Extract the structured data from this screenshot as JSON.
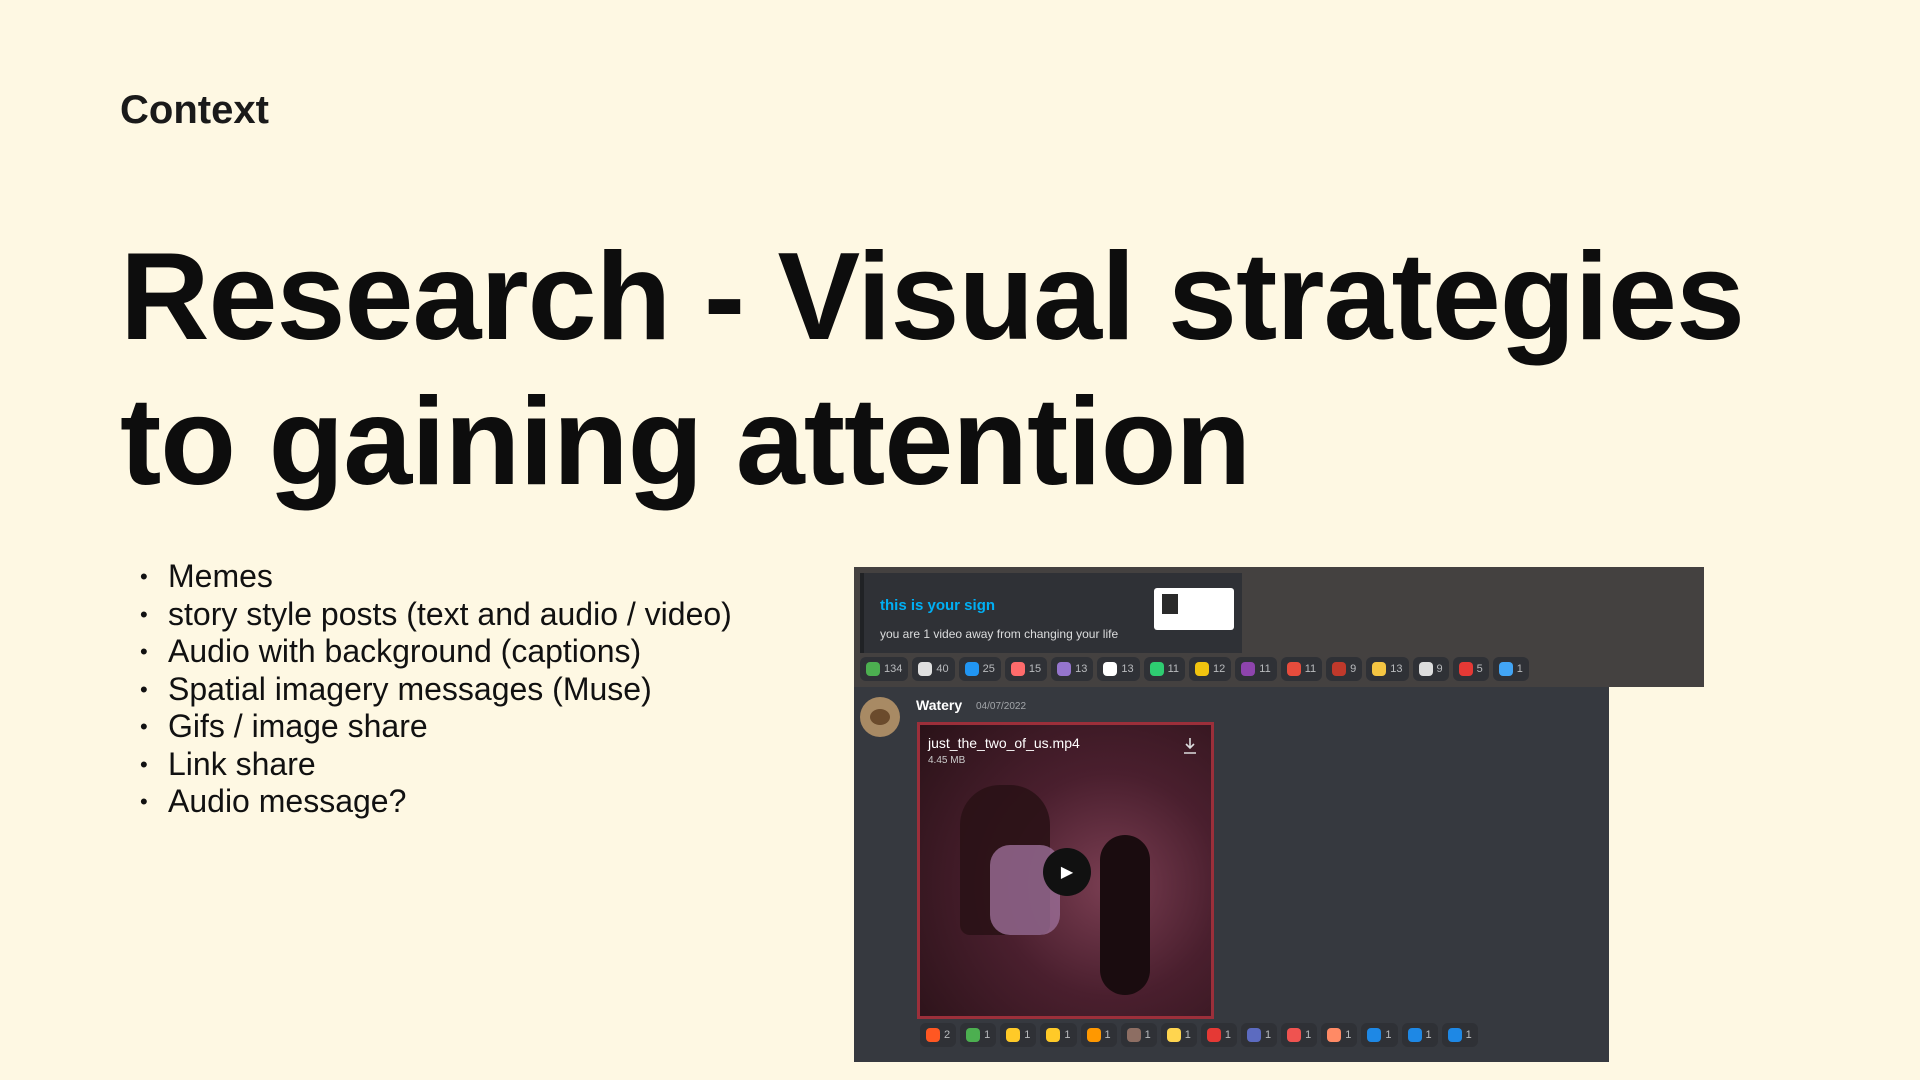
{
  "slide": {
    "eyebrow": "Context",
    "title_line1": "Research - Visual strategies",
    "title_line2": "to gaining attention",
    "bullets": [
      "Memes",
      "story style posts (text and audio / video)",
      "Audio with background (captions)",
      "Spatial imagery messages (Muse)",
      "Gifs / image share",
      "Link share",
      "Audio message?"
    ]
  },
  "screenshot": {
    "embed": {
      "title": "this is your sign",
      "description": "you are 1 video away from changing your life"
    },
    "top_reactions": [
      {
        "icon": "island-emoji",
        "color": "#4caf50",
        "count": "134"
      },
      {
        "icon": "eyes-emoji",
        "color": "#e0e0e0",
        "count": "40"
      },
      {
        "icon": "wave-emoji",
        "color": "#2196f3",
        "count": "25"
      },
      {
        "icon": "pink-emoji",
        "color": "#ff6b6b",
        "count": "15"
      },
      {
        "icon": "sticker-emoji",
        "color": "#9575cd",
        "count": "13"
      },
      {
        "icon": "frame-emoji",
        "color": "#ffffff",
        "count": "13"
      },
      {
        "icon": "green-emoji",
        "color": "#2ecc71",
        "count": "11"
      },
      {
        "icon": "candle-emoji",
        "color": "#f1c40f",
        "count": "12"
      },
      {
        "icon": "purple-emoji",
        "color": "#8e44ad",
        "count": "11"
      },
      {
        "icon": "heart-emoji",
        "color": "#e74c3c",
        "count": "11"
      },
      {
        "icon": "pin-emoji",
        "color": "#c0392b",
        "count": "9"
      },
      {
        "icon": "blob-emoji",
        "color": "#f4c542",
        "count": "13"
      },
      {
        "icon": "diamond-emoji",
        "color": "#dddddd",
        "count": "9"
      },
      {
        "icon": "red-emoji",
        "color": "#e53935",
        "count": "5"
      },
      {
        "icon": "butterfly-emoji",
        "color": "#42a5f5",
        "count": "1"
      }
    ],
    "message": {
      "username": "Watery",
      "date": "04/07/2022",
      "video_name": "just_the_two_of_us.mp4",
      "video_size": "4.45 MB"
    },
    "bottom_reactions": [
      {
        "icon": "arrow-up-emoji",
        "color": "#ff5722",
        "count": "2"
      },
      {
        "icon": "check-emoji",
        "color": "#4caf50",
        "count": "1"
      },
      {
        "icon": "thumbs-up-emoji",
        "color": "#ffca28",
        "count": "1"
      },
      {
        "icon": "grin-emoji",
        "color": "#ffca28",
        "count": "1"
      },
      {
        "icon": "fire-emoji",
        "color": "#ff9800",
        "count": "1"
      },
      {
        "icon": "bird-emoji",
        "color": "#8d6e63",
        "count": "1"
      },
      {
        "icon": "smile-emoji",
        "color": "#ffd54f",
        "count": "1"
      },
      {
        "icon": "red-heart-emoji",
        "color": "#e53935",
        "count": "1"
      },
      {
        "icon": "blue-emoji",
        "color": "#5c6bc0",
        "count": "1"
      },
      {
        "icon": "badge-emoji",
        "color": "#ef5350",
        "count": "1"
      },
      {
        "icon": "face-emoji",
        "color": "#ff8a65",
        "count": "1"
      },
      {
        "icon": "letter-y-emoji",
        "color": "#1e88e5",
        "count": "1"
      },
      {
        "icon": "letter-e-emoji",
        "color": "#1e88e5",
        "count": "1"
      },
      {
        "icon": "letter-s-emoji",
        "color": "#1e88e5",
        "count": "1"
      }
    ]
  }
}
